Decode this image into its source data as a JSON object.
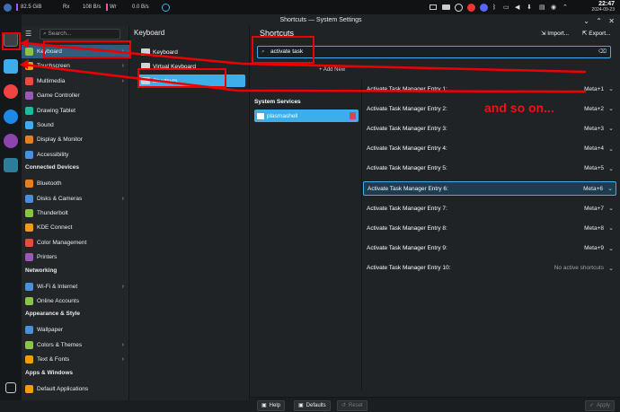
{
  "topbar": {
    "disk": "82.5 GiB",
    "rx_label": "Rx",
    "net_rx": "108 B/s",
    "net_wr": "Wr",
    "net_wr_val": "0.0 B/s",
    "clock_time": "22:47",
    "clock_date": "2024-09-23"
  },
  "window": {
    "title": "Shortcuts — System Settings"
  },
  "sidebar": {
    "search_placeholder": "Search...",
    "items_top": [
      {
        "label": "Keyboard",
        "icon": "keyboard-icon",
        "arrow": true,
        "selected": true
      },
      {
        "label": "Touchscreen",
        "icon": "touchscreen-icon",
        "arrow": true
      },
      {
        "label": "Multimedia",
        "icon": "multimedia-icon",
        "arrow": true
      },
      {
        "label": "Game Controller",
        "icon": "gamepad-icon"
      },
      {
        "label": "Drawing Tablet",
        "icon": "tablet-icon"
      },
      {
        "label": "Sound",
        "icon": "sound-icon"
      },
      {
        "label": "Display & Monitor",
        "icon": "display-icon"
      },
      {
        "label": "Accessibility",
        "icon": "accessibility-icon"
      }
    ],
    "section_connected": "Connected Devices",
    "items_connected": [
      {
        "label": "Bluetooth",
        "icon": "bluetooth-icon"
      },
      {
        "label": "Disks & Cameras",
        "icon": "disks-icon",
        "arrow": true
      },
      {
        "label": "Thunderbolt",
        "icon": "thunderbolt-icon"
      },
      {
        "label": "KDE Connect",
        "icon": "kdeconnect-icon"
      },
      {
        "label": "Color Management",
        "icon": "color-icon"
      },
      {
        "label": "Printers",
        "icon": "printer-icon"
      }
    ],
    "section_networking": "Networking",
    "items_networking": [
      {
        "label": "Wi-Fi & Internet",
        "icon": "wifi-icon",
        "arrow": true
      },
      {
        "label": "Online Accounts",
        "icon": "accounts-icon"
      }
    ],
    "section_appearance": "Appearance & Style",
    "items_appearance": [
      {
        "label": "Wallpaper",
        "icon": "wallpaper-icon"
      },
      {
        "label": "Colors & Themes",
        "icon": "themes-icon",
        "arrow": true
      },
      {
        "label": "Text & Fonts",
        "icon": "fonts-icon",
        "arrow": true
      }
    ],
    "section_apps": "Apps & Windows",
    "items_apps": [
      {
        "label": "Default Applications",
        "icon": "default-apps-icon"
      }
    ]
  },
  "col2": {
    "header": "Keyboard",
    "items": [
      {
        "label": "Keyboard"
      },
      {
        "label": "Virtual Keyboard"
      },
      {
        "label": "Shortcuts",
        "selected": true
      }
    ]
  },
  "main": {
    "header": "Shortcuts",
    "import_label": "Import...",
    "export_label": "Export...",
    "search_value": "activate task",
    "add_label": "Add New",
    "services_header": "System Services",
    "service_item": "plasmashell",
    "shortcuts": [
      {
        "name": "Activate Task Manager Entry 1:",
        "key": "Meta+1"
      },
      {
        "name": "Activate Task Manager Entry 2:",
        "key": "Meta+2"
      },
      {
        "name": "Activate Task Manager Entry 3:",
        "key": "Meta+3"
      },
      {
        "name": "Activate Task Manager Entry 4:",
        "key": "Meta+4"
      },
      {
        "name": "Activate Task Manager Entry 5:",
        "key": "Meta+5"
      },
      {
        "name": "Activate Task Manager Entry 6:",
        "key": "Meta+6",
        "selected": true
      },
      {
        "name": "Activate Task Manager Entry 7:",
        "key": "Meta+7"
      },
      {
        "name": "Activate Task Manager Entry 8:",
        "key": "Meta+8"
      },
      {
        "name": "Activate Task Manager Entry 9:",
        "key": "Meta+9"
      },
      {
        "name": "Activate Task Manager Entry 10:",
        "key": "No active shortcuts"
      }
    ],
    "bottom": {
      "help": "Help",
      "defaults": "Defaults",
      "reset": "Reset",
      "apply": "Apply"
    }
  },
  "annotation_text": "and so on...",
  "colors": {
    "accent": "#3daee9",
    "annotation": "#e00000",
    "selection": "#2f5c7f"
  }
}
